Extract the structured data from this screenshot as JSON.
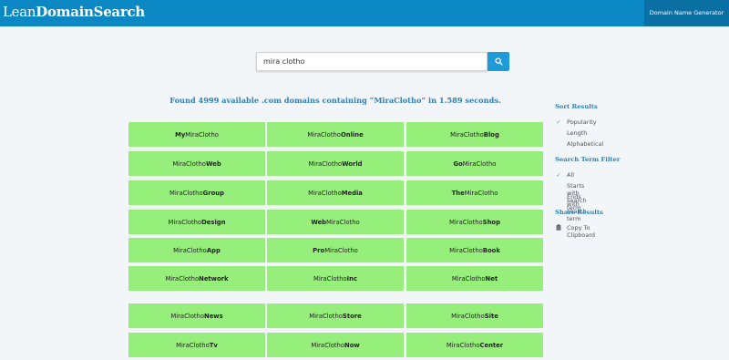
{
  "header": {
    "logo_regular": "Lean",
    "logo_bold": "DomainSearch",
    "generator_label": "Domain Name Generator"
  },
  "search": {
    "value": "mira clotho",
    "button_icon": "search-icon"
  },
  "results": {
    "summary": "Found 4999 available .com domains containing “MiraClotho” in 1.589 seconds.",
    "domains": [
      [
        {
          "pre": "My",
          "base": "MiraClotho",
          "suf": ""
        },
        {
          "pre": "",
          "base": "MiraClotho",
          "suf": "Online"
        },
        {
          "pre": "",
          "base": "MiraClotho",
          "suf": "Blog"
        }
      ],
      [
        {
          "pre": "",
          "base": "MiraClotho",
          "suf": "Web"
        },
        {
          "pre": "",
          "base": "MiraClotho",
          "suf": "World"
        },
        {
          "pre": "Go",
          "base": "MiraClotho",
          "suf": ""
        }
      ],
      [
        {
          "pre": "",
          "base": "MiraClotho",
          "suf": "Group"
        },
        {
          "pre": "",
          "base": "MiraClotho",
          "suf": "Media"
        },
        {
          "pre": "The",
          "base": "MiraClotho",
          "suf": ""
        }
      ],
      [
        {
          "pre": "",
          "base": "MiraClotho",
          "suf": "Design"
        },
        {
          "pre": "Web",
          "base": "MiraClotho",
          "suf": ""
        },
        {
          "pre": "",
          "base": "MiraClotho",
          "suf": "Shop"
        }
      ],
      [
        {
          "pre": "",
          "base": "MiraClotho",
          "suf": "App"
        },
        {
          "pre": "Pro",
          "base": "MiraClotho",
          "suf": ""
        },
        {
          "pre": "",
          "base": "MiraClotho",
          "suf": "Book"
        }
      ],
      [
        {
          "pre": "",
          "base": "MiraClotho",
          "suf": "Network"
        },
        {
          "pre": "",
          "base": "MiraClotho",
          "suf": "Inc"
        },
        {
          "pre": "",
          "base": "MiraClotho",
          "suf": "Net"
        }
      ],
      [
        {
          "pre": "",
          "base": "MiraClotho",
          "suf": "News"
        },
        {
          "pre": "",
          "base": "MiraClotho",
          "suf": "Store"
        },
        {
          "pre": "",
          "base": "MiraClotho",
          "suf": "Site"
        }
      ],
      [
        {
          "pre": "",
          "base": "MiraClotho",
          "suf": "Tv"
        },
        {
          "pre": "",
          "base": "MiraClotho",
          "suf": "Now"
        },
        {
          "pre": "",
          "base": "MiraClotho",
          "suf": "Center"
        }
      ]
    ]
  },
  "sidebar": {
    "sort": {
      "heading": "Sort Results",
      "options": [
        {
          "label": "Popularity",
          "checked": true
        },
        {
          "label": "Length",
          "checked": false
        },
        {
          "label": "Alphabetical",
          "checked": false
        }
      ]
    },
    "filter": {
      "heading": "Search Term Filter",
      "options": [
        {
          "label": "All",
          "checked": true
        },
        {
          "label": "Starts with search term",
          "checked": false
        },
        {
          "label": "Ends with search term",
          "checked": false
        }
      ]
    },
    "share": {
      "heading": "Share Results",
      "copy_label": "Copy To Clipboard",
      "copy_icon": "clipboard-icon"
    }
  },
  "colors": {
    "header": "#0b87c3",
    "tile": "#96ee7b",
    "accent": "#2f7fb3",
    "check": "#5cc164"
  }
}
